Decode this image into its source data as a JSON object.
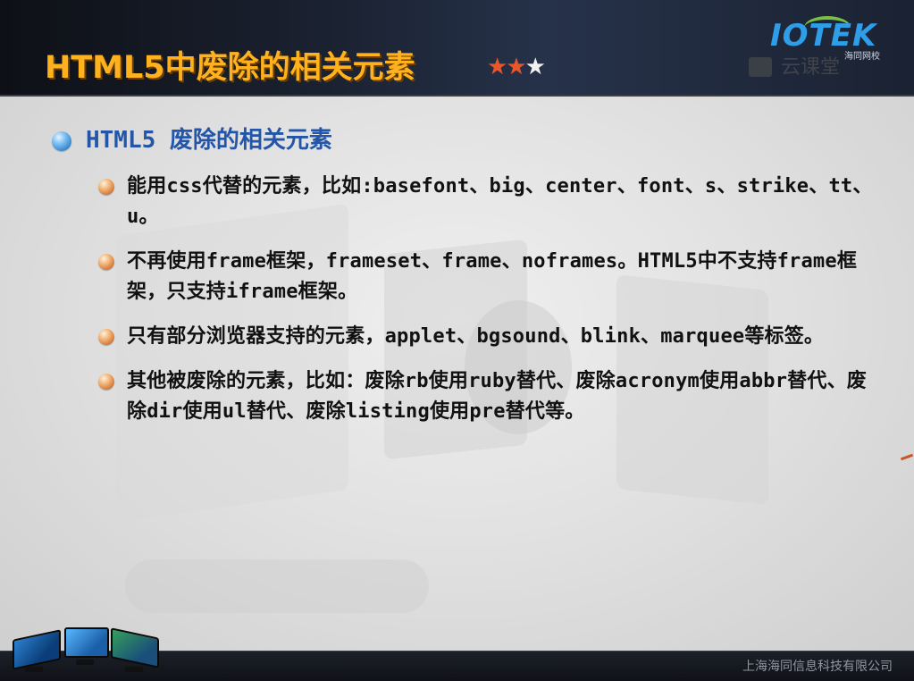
{
  "header": {
    "title": "HTML5中废除的相关元素",
    "stars": {
      "filled": "★★",
      "empty": "★",
      "rating": 2,
      "max": 3
    },
    "logo": {
      "text": "IOTEK",
      "subtext": "海同网校"
    },
    "watermark": "云课堂"
  },
  "main": {
    "heading": "HTML5 废除的相关元素",
    "items": [
      {
        "text": "能用css代替的元素，比如:basefont、big、center、font、s、strike、tt、u。"
      },
      {
        "text": "不再使用frame框架，frameset、frame、noframes。HTML5中不支持frame框架，只支持iframe框架。"
      },
      {
        "text": "只有部分浏览器支持的元素，applet、bgsound、blink、marquee等标签。"
      },
      {
        "text": "其他被废除的元素，比如：废除rb使用ruby替代、废除acronym使用abbr替代、废除dir使用ul替代、废除listing使用pre替代等。"
      }
    ]
  },
  "footer": {
    "company": "上海海同信息科技有限公司"
  },
  "colors": {
    "title": "#ffb21e",
    "heading": "#2356a8",
    "star_on": "#e9562a",
    "star_off": "#f2f2f2",
    "logo": "#2f9ee8"
  }
}
